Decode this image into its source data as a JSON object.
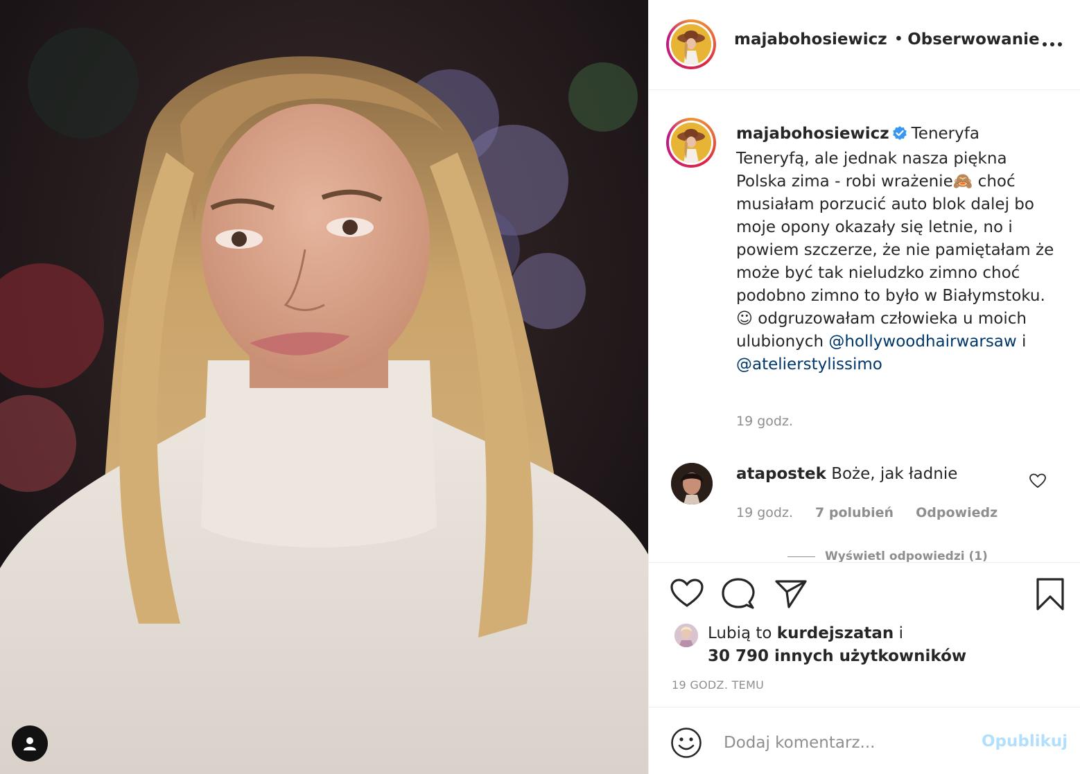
{
  "post": {
    "author": "majabohosiewicz",
    "header_separator": "•",
    "follow_status": "Obserwowanie",
    "more_icon": "more-horizontal-icon",
    "caption": {
      "author": "majabohosiewicz",
      "text": "Teneryfa Teneryfą, ale jednak nasza piękna Polska zima - robi wrażenie🙈 choć musiałam porzucić auto blok dalej bo moje opony okazały się letnie, no i powiem szczerze, że nie pamiętałam że może być tak nieludzko zimno choć podobno zimno to było w Białymstoku. ☺ odgruzowałam człowieka u moich ulubionych",
      "mention_1": "@hollywoodhairwarsaw",
      "connector": "i",
      "mention_2": "@atelierstylissimo",
      "time": "19 godz."
    },
    "comments": [
      {
        "user": "atapostek",
        "text": "Boże, jak ładnie",
        "time": "19 godz.",
        "likes": "7 polubień",
        "reply": "Odpowiedz",
        "view_replies": "Wyświetl odpowiedzi (1)"
      }
    ],
    "likes": {
      "prefix": "Lubią to",
      "user": "kurdejszatan",
      "and": "i",
      "others": "30 790 innych użytkowników"
    },
    "time_ago": "19 GODZ. TEMU",
    "add_comment": {
      "placeholder": "Dodaj komentarz...",
      "publish": "Opublikuj"
    }
  },
  "colors": {
    "text": "#262626",
    "muted": "#8e8e8e",
    "link": "#00376b",
    "verified": "#3897f0",
    "publish_disabled": "#b2dffc",
    "avatar_bg": "#e7b435"
  }
}
